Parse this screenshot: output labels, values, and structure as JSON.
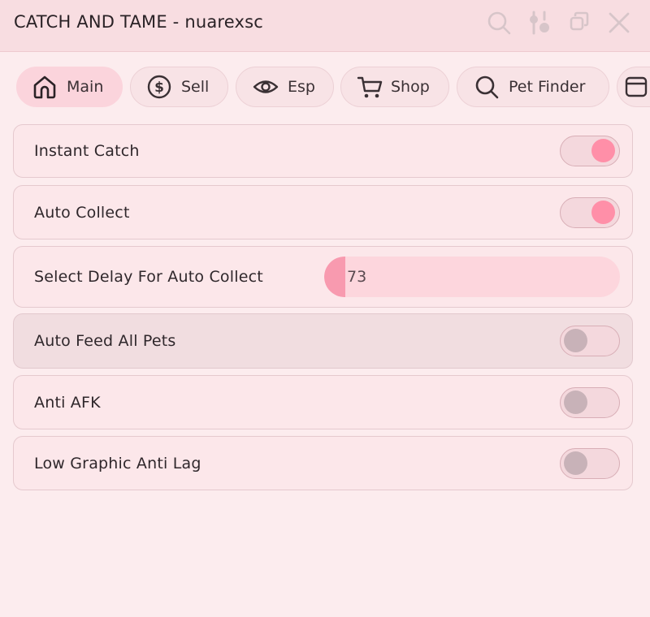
{
  "window": {
    "title": "CATCH AND TAME - nuarexsc",
    "icons": [
      "search-icon",
      "settings-sliders-icon",
      "restore-window-icon",
      "close-icon"
    ]
  },
  "tabs": [
    {
      "label": "Main",
      "icon": "home-icon",
      "active": true
    },
    {
      "label": "Sell",
      "icon": "dollar-circle-icon",
      "active": false
    },
    {
      "label": "Esp",
      "icon": "eye-icon",
      "active": false
    },
    {
      "label": "Shop",
      "icon": "cart-icon",
      "active": false
    },
    {
      "label": "Pet Finder",
      "icon": "search-icon",
      "active": false
    },
    {
      "label": "",
      "icon": "partial-tab-icon",
      "active": false
    }
  ],
  "options": {
    "instant_catch": {
      "label": "Instant Catch",
      "enabled": true
    },
    "auto_collect": {
      "label": "Auto Collect",
      "enabled": true
    },
    "delay": {
      "label": "Select Delay For Auto Collect",
      "value": "73"
    },
    "auto_feed": {
      "label": "Auto Feed All Pets",
      "enabled": false
    },
    "anti_afk": {
      "label": "Anti AFK",
      "enabled": false
    },
    "low_graphic": {
      "label": "Low Graphic Anti Lag",
      "enabled": false
    }
  },
  "colors": {
    "accent": "#ff8fa8",
    "background": "#fcecee",
    "titlebar": "#f8dde1",
    "row_border": "#e5c9ce"
  }
}
